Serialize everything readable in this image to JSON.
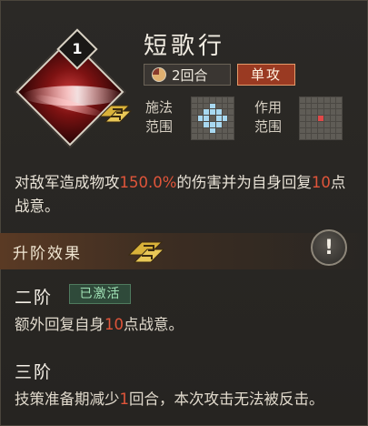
{
  "skill": {
    "level": "1",
    "name": "短歌行",
    "rounds": "2回合",
    "type": "单攻"
  },
  "range": {
    "cast_label_1": "施法",
    "cast_label_2": "范围",
    "effect_label_1": "作用",
    "effect_label_2": "范围"
  },
  "description": {
    "part1": "对敌军造成物攻",
    "value1": "150.0%",
    "part2": "的伤害并为自身回复",
    "value2": "10",
    "part3": "点战意。"
  },
  "upgrade": {
    "title": "升阶效果"
  },
  "tiers": [
    {
      "title": "二阶",
      "status": "已激活",
      "text_part1": "额外回复自身",
      "value": "10",
      "text_part2": "点战意。"
    },
    {
      "title": "三阶",
      "text_part1": "技策准备期减少",
      "value": "1",
      "text_part2": "回合，本次攻击无法被反击。"
    }
  ],
  "colors": {
    "highlight": "#e0553a",
    "type_tag_bg": "#9a3a22",
    "activated_text": "#9fe0b4"
  }
}
